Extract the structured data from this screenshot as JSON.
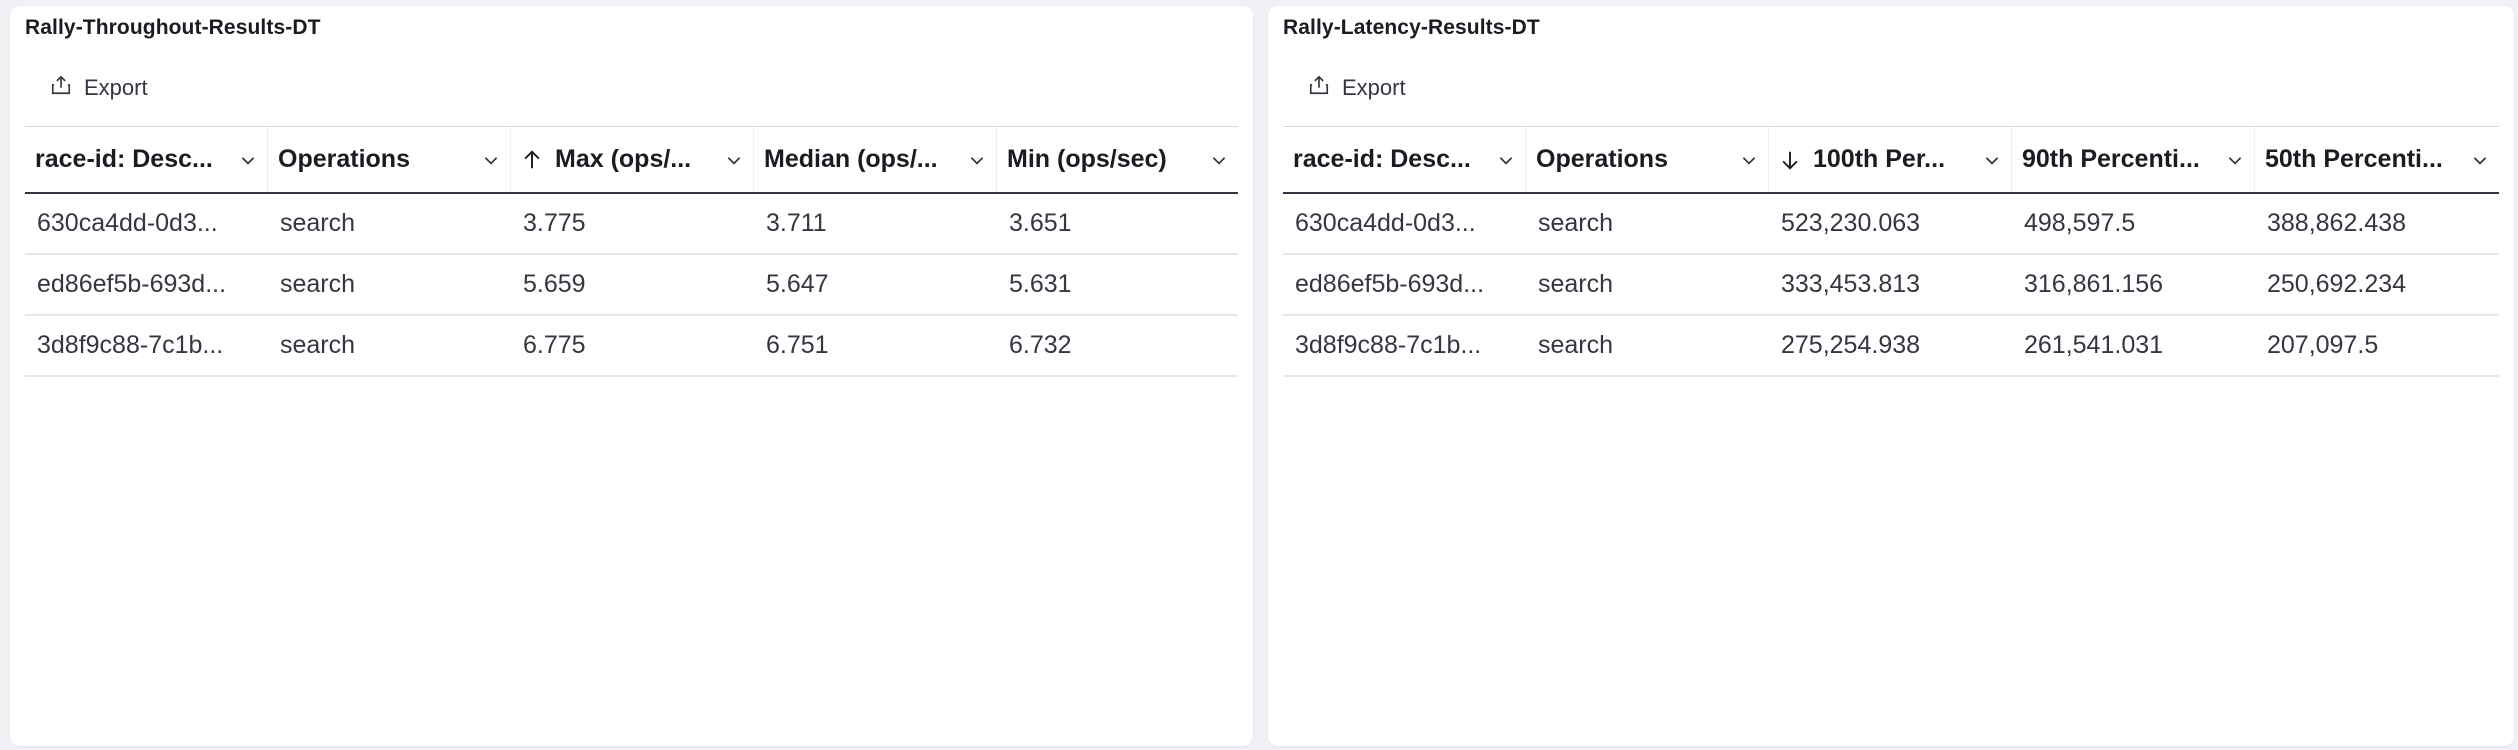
{
  "panels": [
    {
      "title": "Rally-Throughout-Results-DT",
      "export_label": "Export",
      "columns": [
        {
          "label": "race-id: Desc...",
          "sort": null
        },
        {
          "label": "Operations",
          "sort": null
        },
        {
          "label": "Max (ops/...",
          "sort": "ascending"
        },
        {
          "label": "Median (ops/...",
          "sort": null
        },
        {
          "label": "Min (ops/sec)",
          "sort": null
        }
      ],
      "rows": [
        [
          "630ca4dd-0d3...",
          "search",
          "3.775",
          "3.711",
          "3.651"
        ],
        [
          "ed86ef5b-693d...",
          "search",
          "5.659",
          "5.647",
          "5.631"
        ],
        [
          "3d8f9c88-7c1b...",
          "search",
          "6.775",
          "6.751",
          "6.732"
        ]
      ]
    },
    {
      "title": "Rally-Latency-Results-DT",
      "export_label": "Export",
      "columns": [
        {
          "label": "race-id: Desc...",
          "sort": null
        },
        {
          "label": "Operations",
          "sort": null
        },
        {
          "label": "100th Per...",
          "sort": "descending"
        },
        {
          "label": "90th Percenti...",
          "sort": null
        },
        {
          "label": "50th Percenti...",
          "sort": null
        }
      ],
      "rows": [
        [
          "630ca4dd-0d3...",
          "search",
          "523,230.063",
          "498,597.5",
          "388,862.438"
        ],
        [
          "ed86ef5b-693d...",
          "search",
          "333,453.813",
          "316,861.156",
          "250,692.234"
        ],
        [
          "3d8f9c88-7c1b...",
          "search",
          "275,254.938",
          "261,541.031",
          "207,097.5"
        ]
      ]
    }
  ],
  "icons": {
    "export": "export-icon",
    "sort_up": "arrow-up-icon",
    "sort_down": "arrow-down-icon",
    "column_menu": "chevron-down-icon"
  },
  "colors": {
    "background": "#f0f1f4",
    "panel": "#ffffff",
    "text": "#1a1c21",
    "header_rule": "#343741",
    "row_rule": "#e3e7ee"
  }
}
